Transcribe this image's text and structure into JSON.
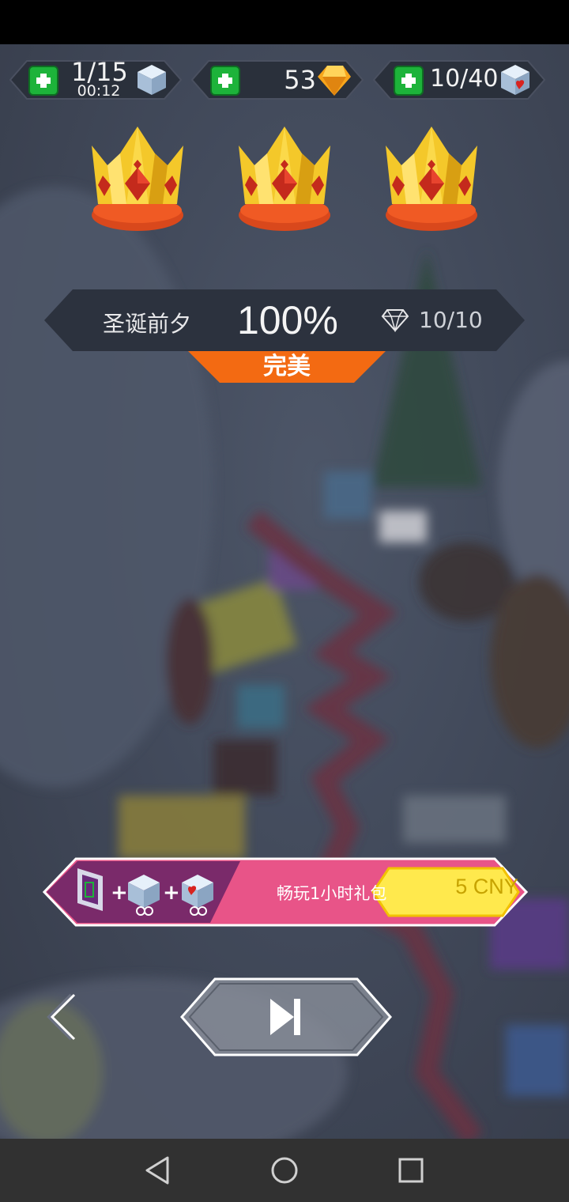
{
  "resources": {
    "cubes": {
      "count": "1/15",
      "timer": "00:12",
      "icon": "ice-cube-icon"
    },
    "gems": {
      "count": "53",
      "icon": "orange-gem-icon"
    },
    "hearts": {
      "count": "10/40",
      "icon": "heart-cube-icon"
    }
  },
  "crowns": {
    "earned": 3,
    "total": 3
  },
  "result": {
    "level_name": "圣诞前夕",
    "percent": "100%",
    "diamonds": "10/10",
    "rating": "完美"
  },
  "offer": {
    "label": "畅玩1小时礼包",
    "price": "5 CNY"
  },
  "colors": {
    "gold": "#f2c118",
    "orange_tab": "#f36a12",
    "offer_purple": "#7a2a6a",
    "offer_pink": "#e85488",
    "price_yellow": "#ffe94d"
  },
  "nav": {
    "back": "back-triangle-icon",
    "home": "home-circle-icon",
    "recents": "recents-square-icon"
  }
}
